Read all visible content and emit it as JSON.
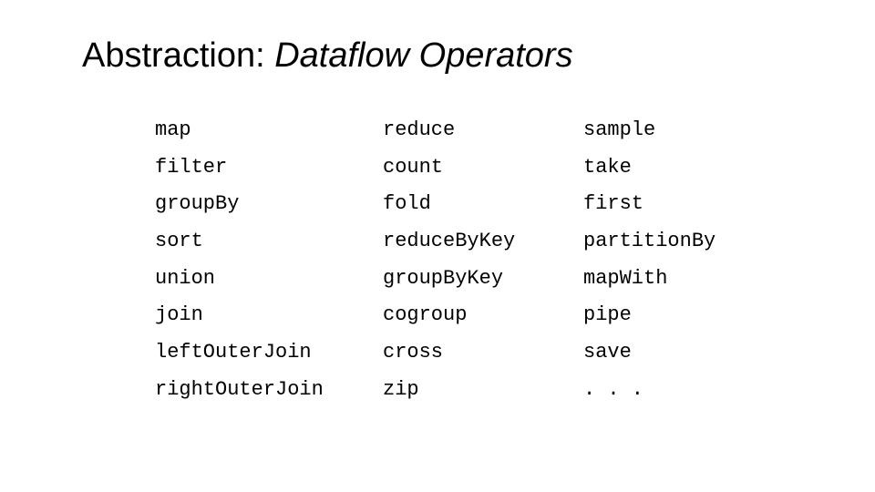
{
  "title": {
    "normal": "Abstraction: ",
    "italic": "Dataflow Operators"
  },
  "columns": {
    "col1": [
      "map",
      "filter",
      "groupBy",
      "sort",
      "union",
      "join",
      "leftOuterJoin",
      "rightOuterJoin"
    ],
    "col2": [
      "reduce",
      "count",
      "fold",
      "reduceByKey",
      "groupByKey",
      "cogroup",
      "cross",
      "zip"
    ],
    "col3": [
      "sample",
      "take",
      "first",
      "partitionBy",
      "mapWith",
      "pipe",
      "save",
      ". . ."
    ]
  }
}
